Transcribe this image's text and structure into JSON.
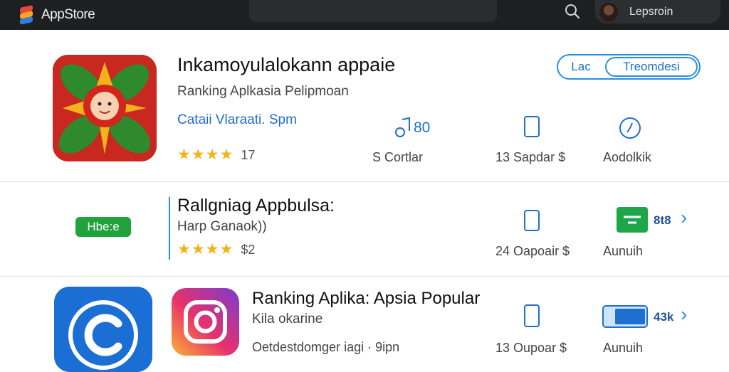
{
  "topbar": {
    "app_name": "AppStore",
    "account_name": "Lepsroin"
  },
  "featured": {
    "title": "Inkamoyulalokann appaie",
    "subtitle": "Ranking Aplkasia Pelipmoan",
    "developer": "Cataii Vlaraati. Spm",
    "stars": "★★★★",
    "rating_count": "17",
    "segment_left": "Lac",
    "segment_right": "Treomdesi",
    "stat_value": "80",
    "stats": [
      "S Cortlar",
      "13 Sapdar $",
      "Aodolkik"
    ]
  },
  "row2": {
    "pill_label": "Hbe:e",
    "title": "Rallgniag Appbulsa:",
    "subtitle": "Harp Ganaok))",
    "stars": "★★★★",
    "rating_count": "$2",
    "stats": [
      "24 Oapoair $",
      "Aunuih"
    ],
    "metric": "8t8"
  },
  "row3": {
    "title": "Ranking Aplika: Apsia Popular",
    "subtitle": "Kila okarine",
    "developer": "Oetdestdomger iagi · 9ipn",
    "stats": [
      "13 Oupoar $",
      "Aunuih"
    ],
    "metric": "43k"
  },
  "colors": {
    "topbar": "#1e1f21",
    "accent_blue": "#2a8fe0",
    "star": "#f2b316",
    "green": "#20a33a"
  },
  "icons": [
    "appstore-logo-icon",
    "search-icon",
    "avatar",
    "music-note-icon",
    "phone-icon",
    "clock-icon",
    "tray-icon",
    "download-card-icon",
    "chevron-right-icon",
    "instagram-icon",
    "app-c-icon"
  ]
}
